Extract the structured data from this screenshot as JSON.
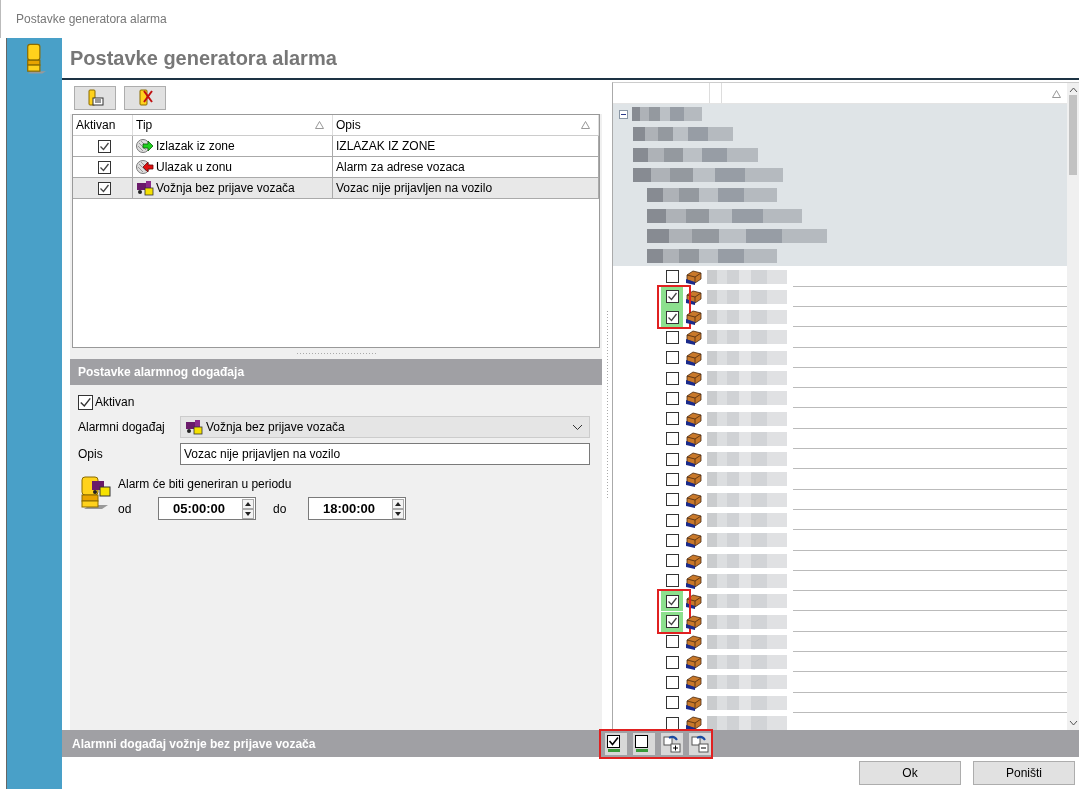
{
  "window": {
    "title": "Postavke generatora alarma"
  },
  "header": {
    "title": "Postavke generatora alarma"
  },
  "alarm_table": {
    "columns": [
      "Aktivan",
      "Tip",
      "Opis"
    ],
    "rows": [
      {
        "active": true,
        "kind": "zone_exit",
        "type": "Izlazak iz zone",
        "description": "IZLAZAK IZ ZONE",
        "selected": false
      },
      {
        "active": true,
        "kind": "zone_enter",
        "type": "Ulazak u zonu",
        "description": "Alarm za adrese vozaca",
        "selected": false
      },
      {
        "active": true,
        "kind": "no_driver",
        "type": "Vožnja bez prijave vozača",
        "description": "Vozac nije prijavljen na vozilo",
        "selected": true
      }
    ]
  },
  "event_settings": {
    "title": "Postavke alarmnog događaja",
    "active_label": "Aktivan",
    "active": true,
    "event_label": "Alarmni događaj",
    "event_value": "Vožnja bez prijave vozača",
    "description_label": "Opis",
    "description_value": "Vozac nije prijavljen na vozilo",
    "period_label": "Alarm će biti generiran u periodu",
    "from_label": "od",
    "from_value": "05:00:00",
    "to_label": "do",
    "to_value": "18:00:00"
  },
  "tree": {
    "root": {
      "kind": "group",
      "expanded": true,
      "children": [
        {
          "kind": "group"
        },
        {
          "kind": "group"
        },
        {
          "kind": "group",
          "children": [
            {
              "kind": "group"
            },
            {
              "kind": "group"
            },
            {
              "kind": "group"
            },
            {
              "kind": "group",
              "children": [
                {
                  "kind": "vehicle",
                  "checked": false
                },
                {
                  "kind": "vehicle",
                  "checked": true
                },
                {
                  "kind": "vehicle",
                  "checked": true
                },
                {
                  "kind": "vehicle",
                  "checked": false
                },
                {
                  "kind": "vehicle",
                  "checked": false
                },
                {
                  "kind": "vehicle",
                  "checked": false
                },
                {
                  "kind": "vehicle",
                  "checked": false
                },
                {
                  "kind": "vehicle",
                  "checked": false
                },
                {
                  "kind": "vehicle",
                  "checked": false
                },
                {
                  "kind": "vehicle",
                  "checked": false
                },
                {
                  "kind": "vehicle",
                  "checked": false
                },
                {
                  "kind": "vehicle",
                  "checked": false
                },
                {
                  "kind": "vehicle",
                  "checked": false
                },
                {
                  "kind": "vehicle",
                  "checked": false
                },
                {
                  "kind": "vehicle",
                  "checked": false
                },
                {
                  "kind": "vehicle",
                  "checked": false
                },
                {
                  "kind": "vehicle",
                  "checked": true
                },
                {
                  "kind": "vehicle",
                  "checked": true
                },
                {
                  "kind": "vehicle",
                  "checked": false
                },
                {
                  "kind": "vehicle",
                  "checked": false
                },
                {
                  "kind": "vehicle",
                  "checked": false
                },
                {
                  "kind": "vehicle",
                  "checked": false
                },
                {
                  "kind": "vehicle",
                  "checked": false
                }
              ]
            }
          ]
        }
      ]
    }
  },
  "bottom_bar": {
    "title": "Alarmni događaj vožnje bez prijave vozača"
  },
  "buttons": [
    "Ok",
    "Poništi"
  ]
}
